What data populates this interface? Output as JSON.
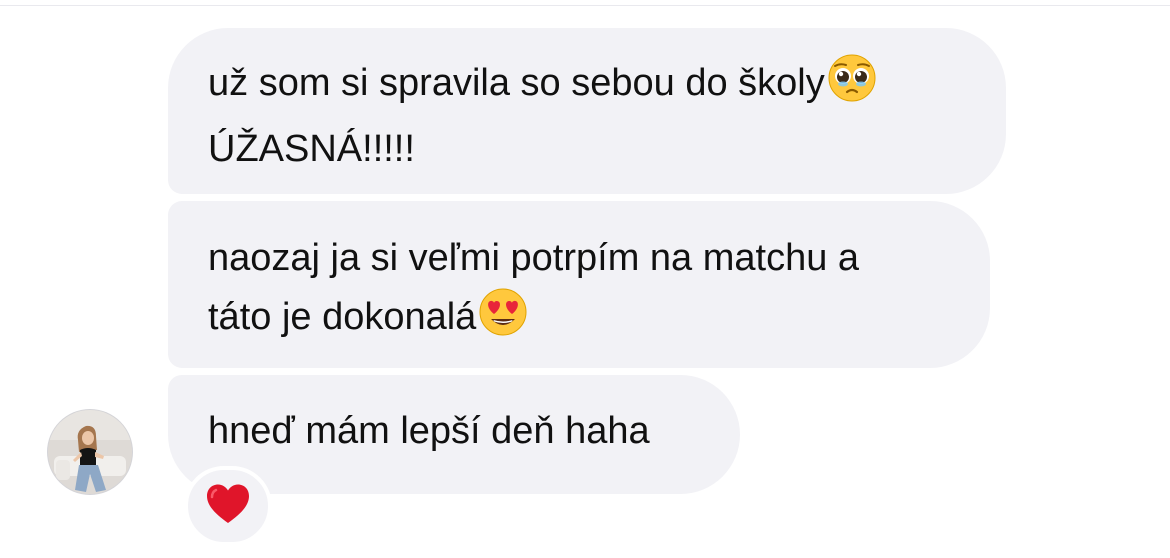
{
  "conversation": {
    "messages": [
      {
        "lines": [
          "už som si spravila so sebou do školy",
          "ÚŽASNÁ!!!!!"
        ],
        "emoji": "pleading-face-icon"
      },
      {
        "lines": [
          "naozaj ja si veľmi potrpím na matchu a",
          "táto je dokonalá"
        ],
        "emoji": "heart-eyes-face-icon"
      },
      {
        "lines": [
          "hneď mám lepší deň haha"
        ],
        "reaction": "red-heart-icon"
      }
    ],
    "sender_avatar": "avatar-photo"
  },
  "colors": {
    "bubble": "#f2f2f6",
    "text": "#111111",
    "heart": "#e0152a",
    "emoji_face": "#ffc83d"
  }
}
